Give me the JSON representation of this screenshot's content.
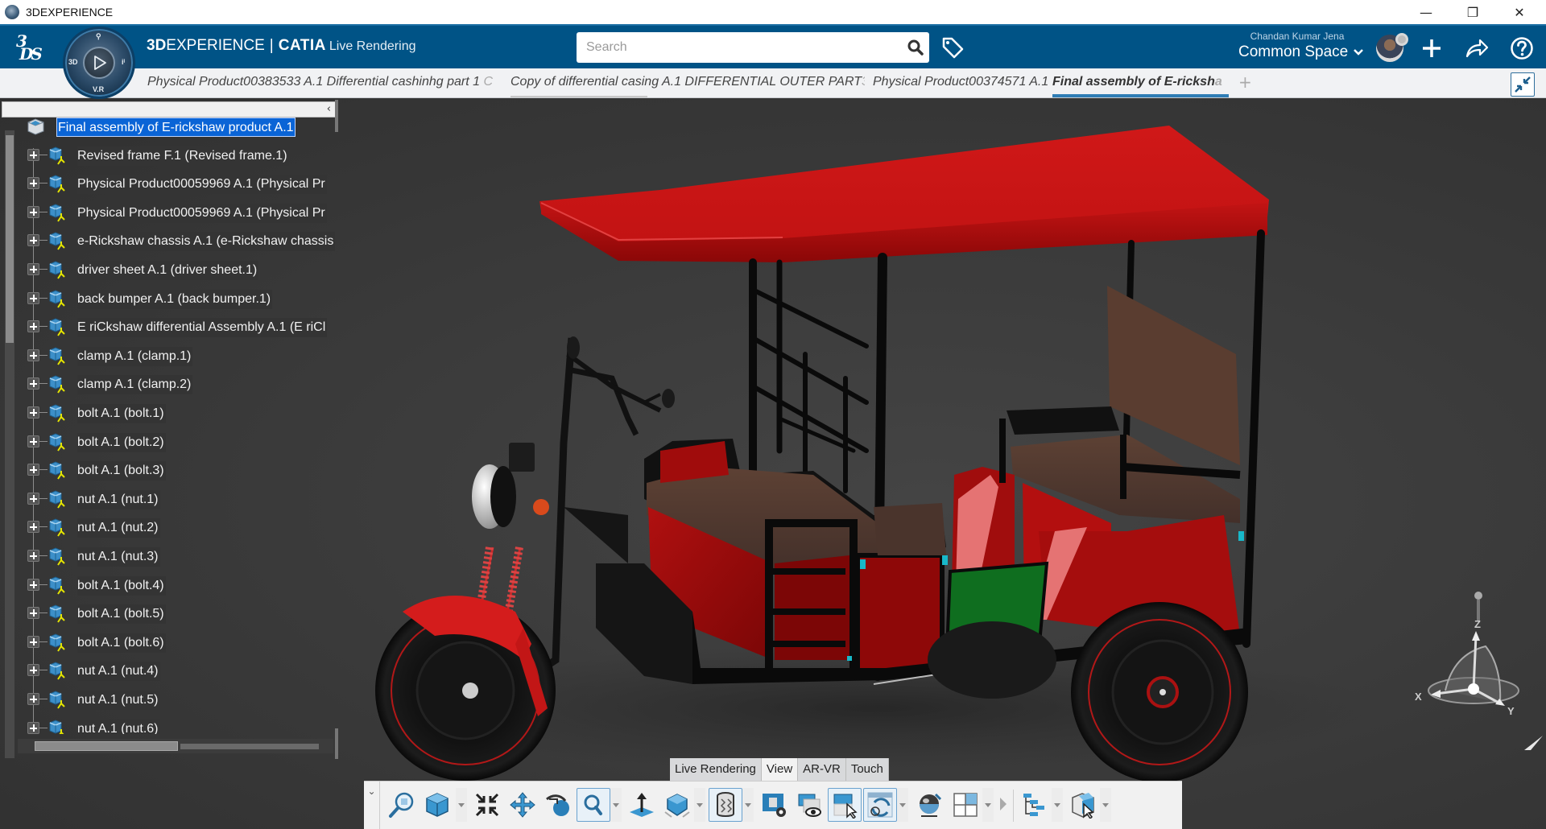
{
  "window": {
    "title": "3DEXPERIENCE",
    "controls": {
      "minimize": "—",
      "maximize": "❐",
      "close": "✕"
    }
  },
  "header": {
    "brand_bold": "3D",
    "brand_rest": "EXPERIENCE",
    "separator": "|",
    "product": "CATIA",
    "app": "Live Rendering",
    "search_placeholder": "Search",
    "user_name": "Chandan Kumar Jena",
    "collaborative_space": "Common Space",
    "icons": [
      "ds-logo-icon",
      "compass-icon",
      "search-icon",
      "tag-icon",
      "avatar",
      "add-icon",
      "share-icon",
      "help-icon"
    ]
  },
  "compass": {
    "top": "⚲",
    "left": "3D",
    "right": "iⁱ",
    "bottom": "V.R"
  },
  "tabs": [
    {
      "label": "Physical Product00383533 A.1 Differential cashinhg part 1 ",
      "fade": "C",
      "active": false
    },
    {
      "label": "Copy of differential casing A.1 DIFFERENTIAL OUTER PART",
      "fade": "3",
      "active": false
    },
    {
      "label": "Physical Product00374571 A.1",
      "fade": "",
      "active": false
    },
    {
      "label": "Final assembly of E-ricksh",
      "fade": "a",
      "active": true
    }
  ],
  "tab_add": "+",
  "tree": {
    "collapse_glyph": "‹",
    "root": "Final assembly of E-rickshaw product A.1",
    "items": [
      "Revised frame F.1 (Revised frame.1)",
      "Physical Product00059969 A.1 (Physical Pr",
      "Physical Product00059969 A.1 (Physical Pr",
      "e-Rickshaw chassis A.1 (e-Rickshaw chassis",
      "driver sheet A.1 (driver sheet.1)",
      "back bumper A.1 (back bumper.1)",
      "E riCkshaw differential Assembly A.1 (E riCl",
      "clamp A.1 (clamp.1)",
      "clamp A.1 (clamp.2)",
      "bolt A.1 (bolt.1)",
      "bolt A.1 (bolt.2)",
      "bolt A.1 (bolt.3)",
      "nut A.1 (nut.1)",
      "nut A.1 (nut.2)",
      "nut A.1 (nut.3)",
      "bolt A.1 (bolt.4)",
      "bolt A.1 (bolt.5)",
      "bolt A.1 (bolt.6)",
      "nut A.1 (nut.4)",
      "nut A.1 (nut.5)",
      "nut A.1 (nut.6)"
    ]
  },
  "toolbar": {
    "tabs": [
      {
        "label": "Live Rendering",
        "active": false
      },
      {
        "label": "View",
        "active": true
      },
      {
        "label": "AR-VR",
        "active": false
      },
      {
        "label": "Touch",
        "active": false
      }
    ],
    "collapse_glyph": "⌄",
    "tools": [
      "zoom-area-icon",
      "view-cube-icon",
      "fit-all-icon",
      "pan-icon",
      "rotate-icon",
      "zoom-icon",
      "normal-view-icon",
      "view-mode-icon",
      "render-style-icon",
      "render-settings-icon",
      "hide-show-icon",
      "selection-mode-icon",
      "reframe-icon",
      "ambience-icon",
      "multi-view-icon",
      "tree-icon",
      "product-select-icon"
    ]
  },
  "triad": {
    "x": "X",
    "y": "Y",
    "z": "Z"
  },
  "colors": {
    "header_blue": "#005386",
    "tab_active_underline": "#2f7db5",
    "selection_blue": "#0a64d6",
    "viewport_bg": "#3b3b3b",
    "roof_red": "#c81515"
  }
}
